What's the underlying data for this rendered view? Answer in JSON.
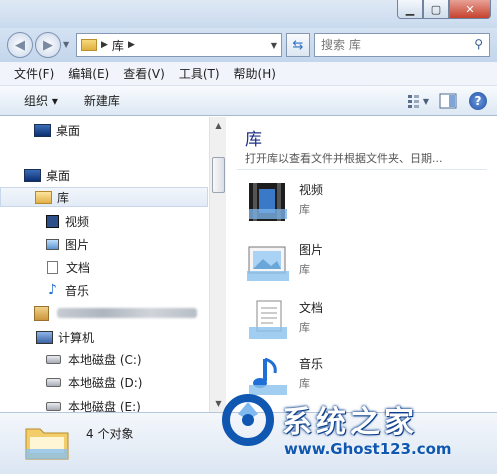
{
  "address": {
    "crumb": "库"
  },
  "search": {
    "placeholder": "搜索 库"
  },
  "menu": [
    "文件(F)",
    "编辑(E)",
    "查看(V)",
    "工具(T)",
    "帮助(H)"
  ],
  "toolbar": {
    "organize": "组织 ▾",
    "new_library": "新建库"
  },
  "nav": {
    "favorites_desktop": "桌面",
    "desktop": "桌面",
    "libraries": "库",
    "videos": "视频",
    "pictures": "图片",
    "documents": "文档",
    "music": "音乐",
    "computer": "计算机",
    "drive_c": "本地磁盘 (C:)",
    "drive_d": "本地磁盘 (D:)",
    "drive_e": "本地磁盘 (E:)"
  },
  "content": {
    "title": "库",
    "subtitle": "打开库以查看文件并根据文件夹、日期...",
    "items": [
      {
        "name": "视频",
        "type": "库",
        "icon": "video-library-icon"
      },
      {
        "name": "图片",
        "type": "库",
        "icon": "pictures-library-icon"
      },
      {
        "name": "文档",
        "type": "库",
        "icon": "documents-library-icon"
      },
      {
        "name": "音乐",
        "type": "库",
        "icon": "music-library-icon"
      }
    ]
  },
  "status": {
    "count": "4 个对象"
  },
  "watermark": {
    "brand": "系统之家",
    "url": "www.Ghost123.com"
  }
}
